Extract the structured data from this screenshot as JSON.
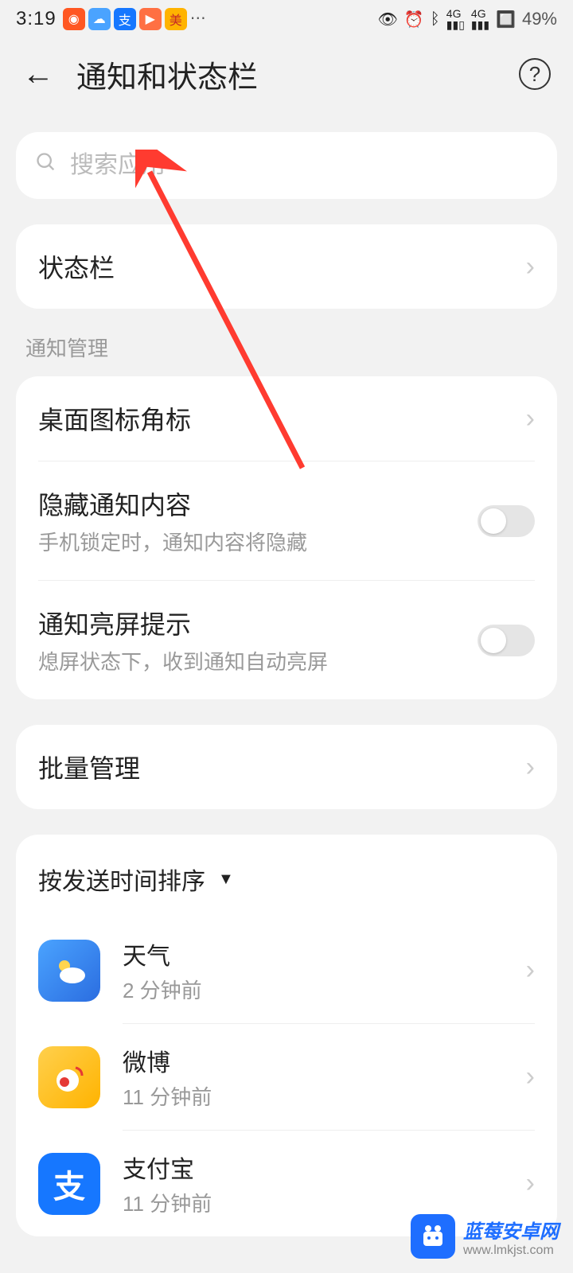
{
  "status": {
    "time": "3:19",
    "battery": "49%"
  },
  "header": {
    "title": "通知和状态栏"
  },
  "search": {
    "placeholder": "搜索应用"
  },
  "statusbar_row": {
    "label": "状态栏"
  },
  "section1": {
    "label": "通知管理",
    "items": {
      "badge": {
        "title": "桌面图标角标"
      },
      "hide": {
        "title": "隐藏通知内容",
        "sub": "手机锁定时，通知内容将隐藏"
      },
      "wake": {
        "title": "通知亮屏提示",
        "sub": "熄屏状态下，收到通知自动亮屏"
      }
    }
  },
  "batch": {
    "label": "批量管理"
  },
  "sort": {
    "label": "按发送时间排序"
  },
  "apps": [
    {
      "name": "天气",
      "time": "2 分钟前",
      "icon": "weather"
    },
    {
      "name": "微博",
      "time": "11 分钟前",
      "icon": "weibo"
    },
    {
      "name": "支付宝",
      "time": "11 分钟前",
      "icon": "alipay"
    }
  ],
  "watermark": {
    "title": "蓝莓安卓网",
    "url": "www.lmkjst.com"
  }
}
